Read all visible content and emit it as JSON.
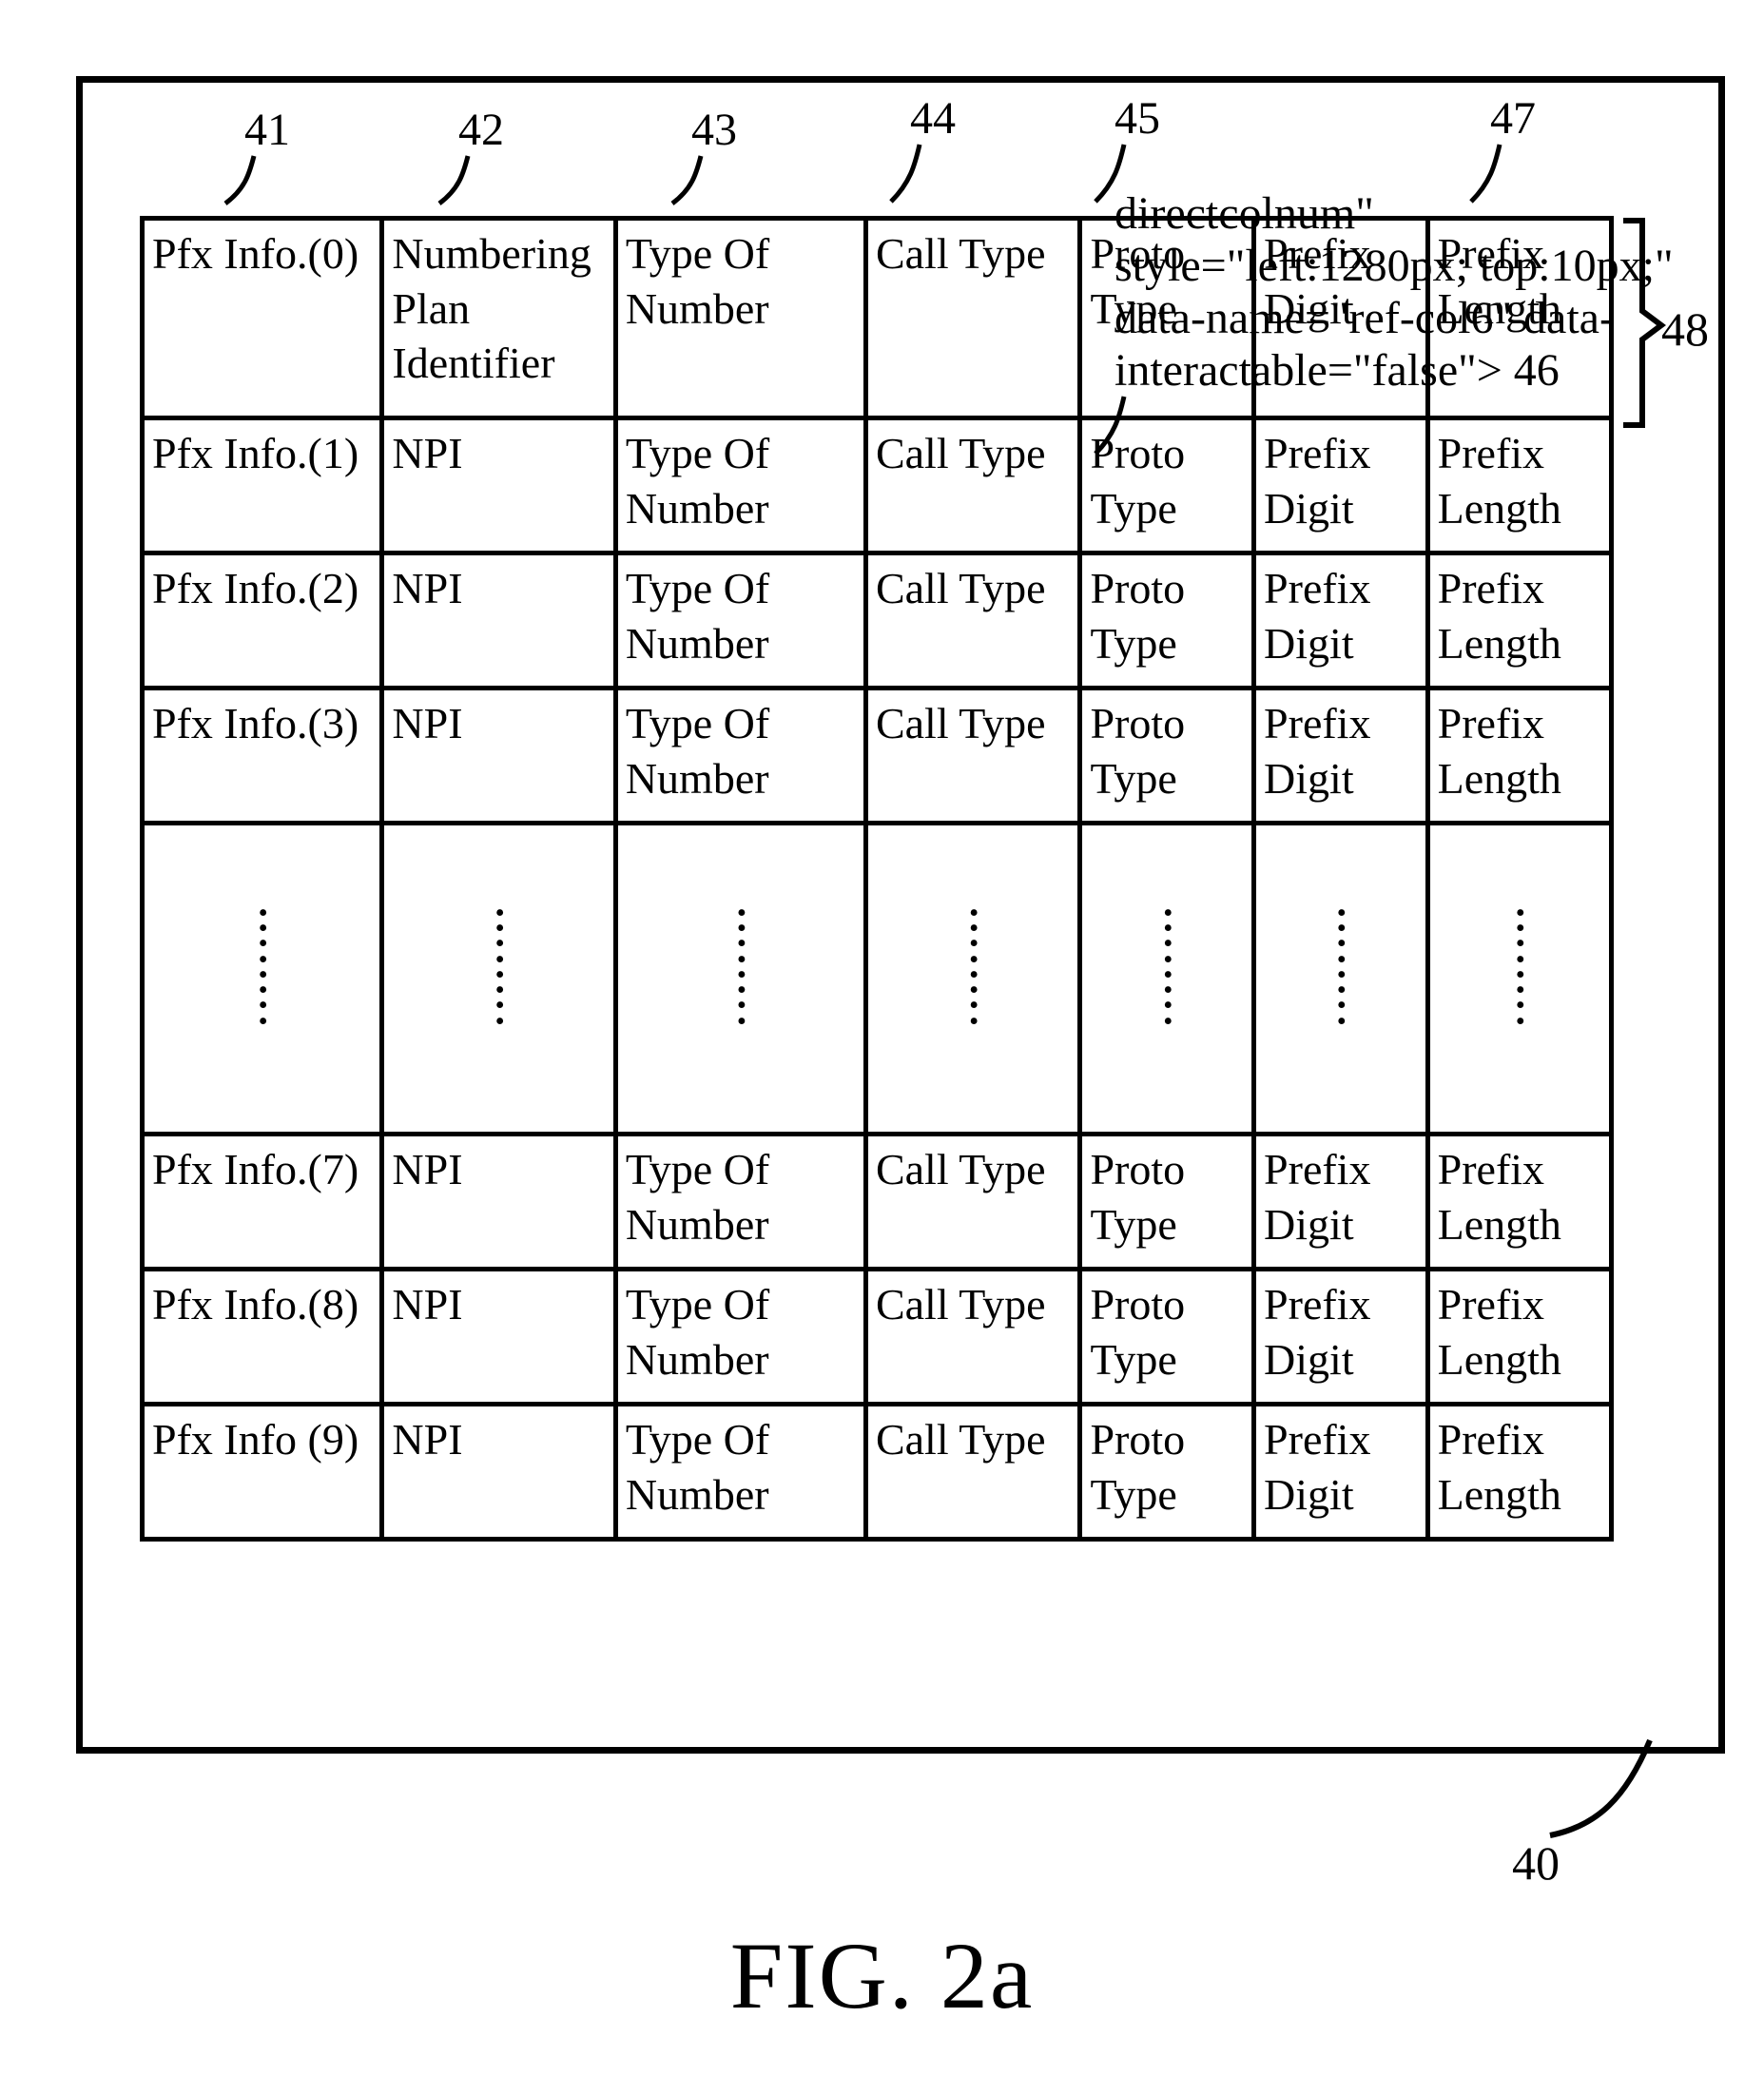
{
  "figure_label": "FIG. 2a",
  "ref_numbers": {
    "col1": "41",
    "col2": "42",
    "col3": "43",
    "col4": "44",
    "col5": "45",
    "col6": "46",
    "col7": "47",
    "row_brace": "48",
    "frame": "40"
  },
  "rows": [
    {
      "c1": "Pfx Info.(0)",
      "c2": "Numbering Plan Identifier",
      "c3": "Type Of Number",
      "c4": "Call Type",
      "c5": "Proto Type",
      "c6": "Prefix Digit",
      "c7": "Prefix Length"
    },
    {
      "c1": "Pfx Info.(1)",
      "c2": "NPI",
      "c3": "Type Of Number",
      "c4": "Call Type",
      "c5": "Proto Type",
      "c6": "Prefix Digit",
      "c7": "Prefix Length"
    },
    {
      "c1": "Pfx Info.(2)",
      "c2": "NPI",
      "c3": "Type Of Number",
      "c4": "Call Type",
      "c5": "Proto Type",
      "c6": "Prefix Digit",
      "c7": "Prefix Length"
    },
    {
      "c1": "Pfx Info.(3)",
      "c2": "NPI",
      "c3": "Type Of Number",
      "c4": "Call Type",
      "c5": "Proto Type",
      "c6": "Prefix Digit",
      "c7": "Prefix Length"
    },
    {
      "ellipsis": true
    },
    {
      "c1": "Pfx Info.(7)",
      "c2": "NPI",
      "c3": "Type Of Number",
      "c4": "Call Type",
      "c5": "Proto Type",
      "c6": "Prefix Digit",
      "c7": "Prefix Length"
    },
    {
      "c1": "Pfx Info.(8)",
      "c2": "NPI",
      "c3": "Type Of Number",
      "c4": "Call Type",
      "c5": "Proto Type",
      "c6": "Prefix Digit",
      "c7": "Prefix Length"
    },
    {
      "c1": "Pfx Info (9)",
      "c2": "NPI",
      "c3": "Type Of Number",
      "c4": "Call Type",
      "c5": "Proto Type",
      "c6": "Prefix Digit",
      "c7": "Prefix Length"
    }
  ],
  "vdots_glyph": "·\n·\n·\n·\n·\n·\n·\n·"
}
